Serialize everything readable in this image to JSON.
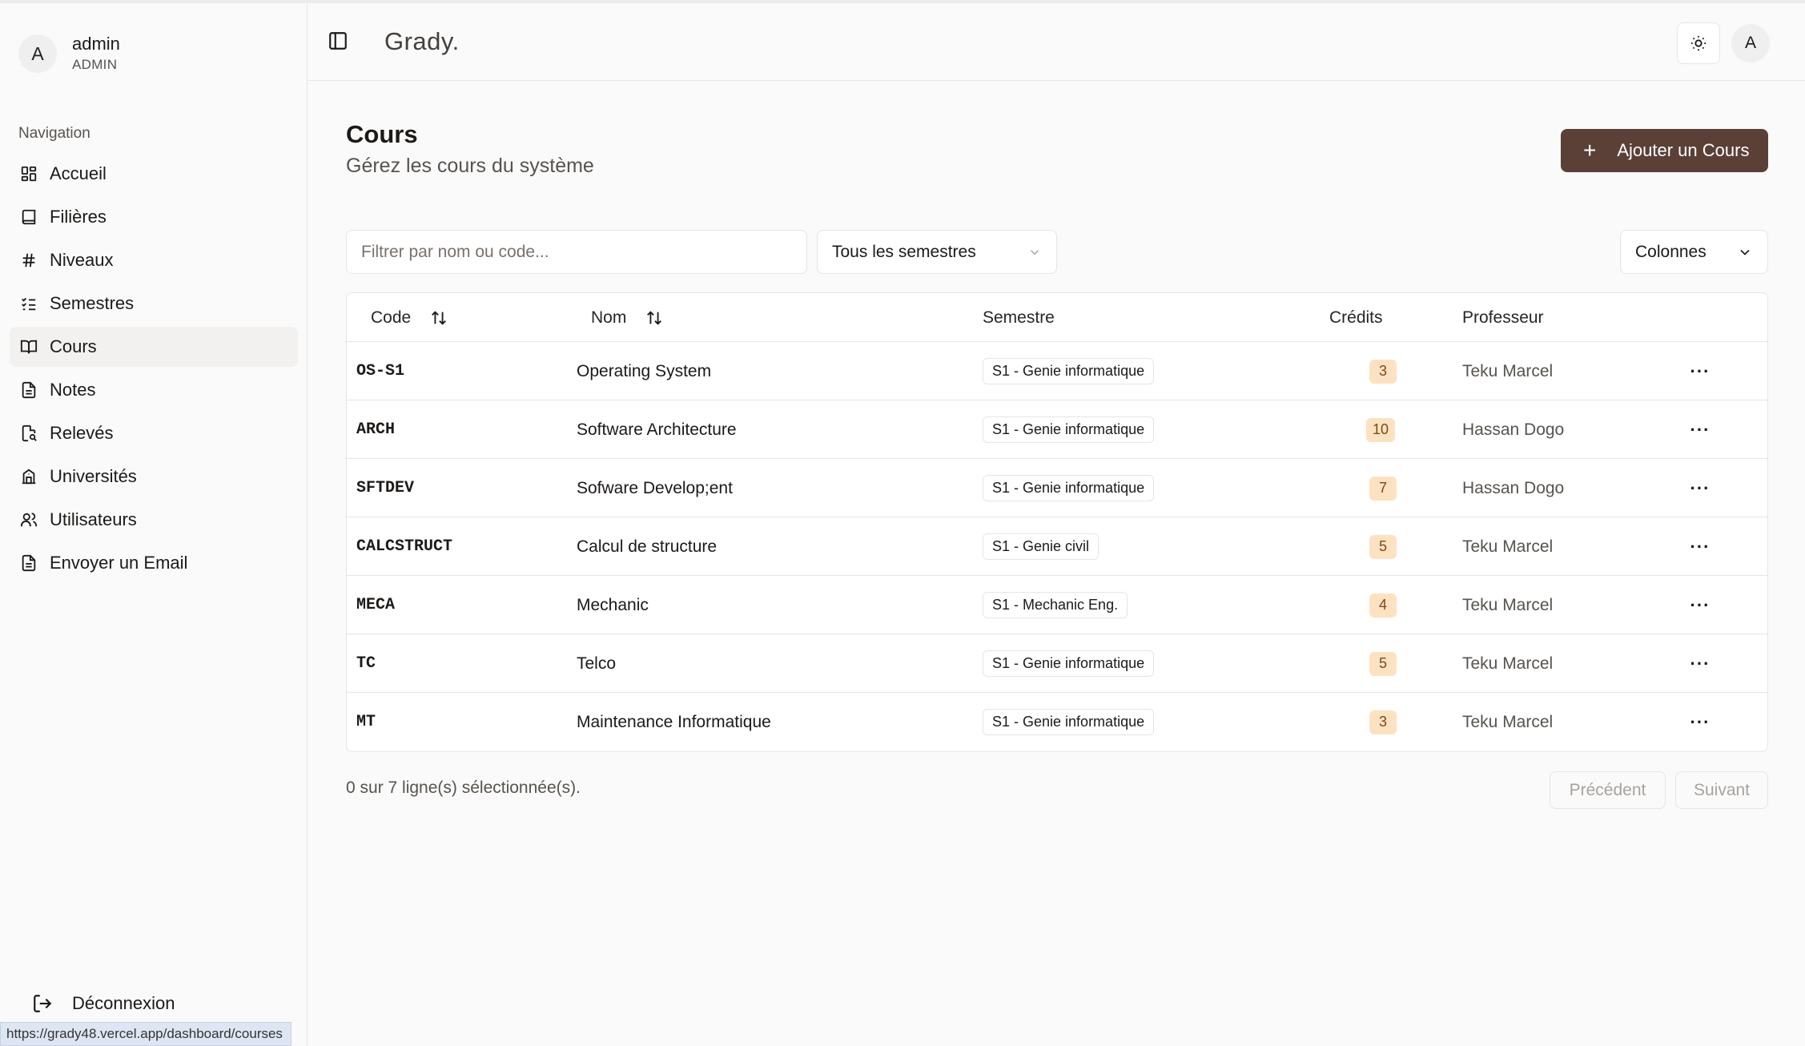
{
  "user": {
    "initial": "A",
    "name": "admin",
    "role": "ADMIN"
  },
  "sidebar": {
    "section_label": "Navigation",
    "items": [
      {
        "label": "Accueil",
        "icon": "dashboard-icon"
      },
      {
        "label": "Filières",
        "icon": "book-icon"
      },
      {
        "label": "Niveaux",
        "icon": "hash-icon"
      },
      {
        "label": "Semestres",
        "icon": "list-checks-icon"
      },
      {
        "label": "Cours",
        "icon": "book-open-icon",
        "active": true
      },
      {
        "label": "Notes",
        "icon": "file-text-icon"
      },
      {
        "label": "Relevés",
        "icon": "file-search-icon"
      },
      {
        "label": "Universités",
        "icon": "building-icon"
      },
      {
        "label": "Utilisateurs",
        "icon": "users-icon"
      },
      {
        "label": "Envoyer un Email",
        "icon": "file-text-icon"
      }
    ],
    "logout_label": "Déconnexion"
  },
  "status_url": "https://grady48.vercel.app/dashboard/courses",
  "header": {
    "brand": "Grady.",
    "avatar_initial": "A"
  },
  "page": {
    "title": "Cours",
    "subtitle": "Gérez les cours du système",
    "add_button": "Ajouter un Cours"
  },
  "filters": {
    "search_placeholder": "Filtrer par nom ou code...",
    "semester_selected": "Tous les semestres",
    "columns_label": "Colonnes"
  },
  "table": {
    "headers": {
      "code": "Code",
      "name": "Nom",
      "semester": "Semestre",
      "credits": "Crédits",
      "professor": "Professeur"
    },
    "rows": [
      {
        "code": "OS-S1",
        "name": "Operating System",
        "semester": "S1 - Genie informatique",
        "credits": "3",
        "professor": "Teku Marcel"
      },
      {
        "code": "ARCH",
        "name": "Software Architecture",
        "semester": "S1 - Genie informatique",
        "credits": "10",
        "professor": "Hassan Dogo"
      },
      {
        "code": "SFTDEV",
        "name": "Sofware Develop;ent",
        "semester": "S1 - Genie informatique",
        "credits": "7",
        "professor": "Hassan Dogo"
      },
      {
        "code": "CALCSTRUCT",
        "name": "Calcul de structure",
        "semester": "S1 - Genie civil",
        "credits": "5",
        "professor": "Teku Marcel"
      },
      {
        "code": "MECA",
        "name": "Mechanic",
        "semester": "S1 - Mechanic Eng.",
        "credits": "4",
        "professor": "Teku Marcel"
      },
      {
        "code": "TC",
        "name": "Telco",
        "semester": "S1 - Genie informatique",
        "credits": "5",
        "professor": "Teku Marcel"
      },
      {
        "code": "MT",
        "name": "Maintenance Informatique",
        "semester": "S1 - Genie informatique",
        "credits": "3",
        "professor": "Teku Marcel"
      }
    ]
  },
  "footer": {
    "selection_info": "0 sur 7 ligne(s) sélectionnée(s).",
    "prev_label": "Précédent",
    "next_label": "Suivant"
  },
  "colors": {
    "accent": "#5b4038",
    "credit_badge_bg": "#fde2c2",
    "credit_badge_fg": "#7a4a16"
  }
}
